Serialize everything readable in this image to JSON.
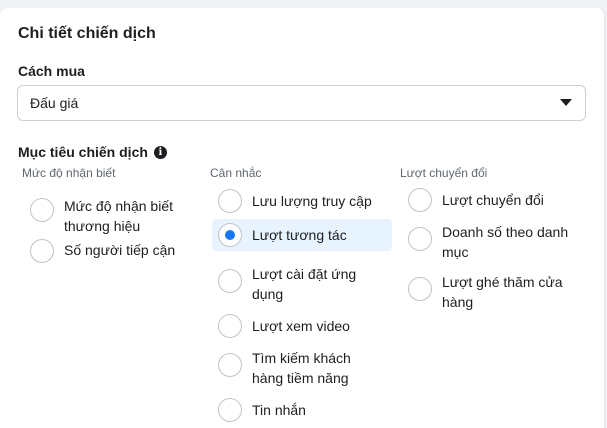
{
  "panel": {
    "title": "Chi tiết chiến dịch",
    "buying_type_label": "Cách mua",
    "buying_type_value": "Đấu giá",
    "objective_label": "Mục tiêu chiến dịch",
    "info_icon_glyph": "i"
  },
  "columns": [
    {
      "header": "Mức độ nhận biết",
      "options": [
        {
          "label_line1": "Mức độ nhận biết",
          "label_line2": "thương hiệu",
          "checked": false
        },
        {
          "label_line1": "Số người tiếp cận",
          "label_line2": "",
          "checked": false
        }
      ]
    },
    {
      "header": "Cân nhắc",
      "options": [
        {
          "label_line1": "Lưu lượng truy cập",
          "label_line2": "",
          "checked": false
        },
        {
          "label_line1": "Lượt tương tác",
          "label_line2": "",
          "checked": true
        },
        {
          "label_line1": "Lượt cài đặt ứng",
          "label_line2": "dụng",
          "checked": false
        },
        {
          "label_line1": "Lượt xem video",
          "label_line2": "",
          "checked": false
        },
        {
          "label_line1": "Tìm kiếm khách",
          "label_line2": "hàng tiềm năng",
          "checked": false
        },
        {
          "label_line1": "Tin nhắn",
          "label_line2": "",
          "checked": false
        }
      ]
    },
    {
      "header": "Lượt chuyển đổi",
      "options": [
        {
          "label_line1": "Lượt chuyển đổi",
          "label_line2": "",
          "checked": false
        },
        {
          "label_line1": "Doanh số theo danh",
          "label_line2": "mục",
          "checked": false
        },
        {
          "label_line1": "Lượt ghé thăm cửa",
          "label_line2": "hàng",
          "checked": false
        }
      ]
    }
  ],
  "colors": {
    "accent": "#1877f2",
    "selected_bg": "#e7f3ff"
  }
}
